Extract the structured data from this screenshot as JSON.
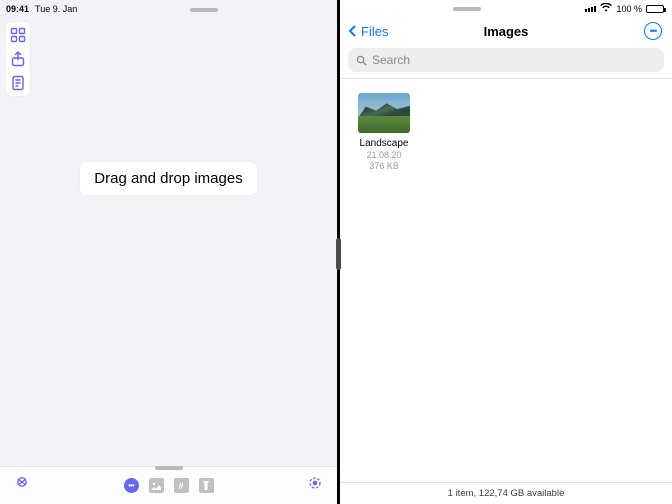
{
  "status_left": {
    "clock": "09:41",
    "date": "Tue 9. Jan"
  },
  "left_pane": {
    "drop_label": "Drag and drop images"
  },
  "status_right": {
    "battery_pct": "100 %"
  },
  "files_nav": {
    "back_label": "Files",
    "title": "Images"
  },
  "search": {
    "placeholder": "Search"
  },
  "file_items": [
    {
      "name": "Landscape",
      "date": "21.08.20",
      "size": "376 KB"
    }
  ],
  "footer": {
    "summary": "1 item, 122,74 GB available"
  }
}
